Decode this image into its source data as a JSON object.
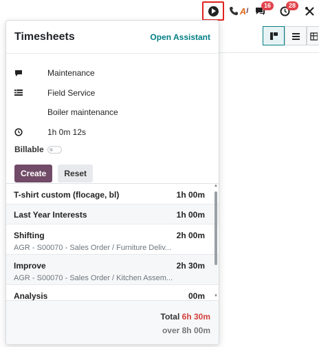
{
  "navbar": {
    "messages_badge": "16",
    "activity_badge": "28"
  },
  "popover": {
    "title": "Timesheets",
    "open_assistant": "Open Assistant",
    "form": {
      "description": "Maintenance",
      "project": "Field Service",
      "task": "Boiler maintenance",
      "duration": "1h 0m 12s",
      "billable_label": "Billable",
      "create_label": "Create",
      "reset_label": "Reset"
    },
    "entries": [
      {
        "title": "T-shirt custom (flocage, bl)",
        "time": "1h 00m",
        "subtitle": ""
      },
      {
        "title": "Last Year Interests",
        "time": "1h 00m",
        "subtitle": ""
      },
      {
        "title": "Shifting",
        "time": "2h 00m",
        "subtitle": "AGR - S00070 - Sales Order / Furniture Deliv..."
      },
      {
        "title": "Improve",
        "time": "2h 30m",
        "subtitle": "AGR - S00070 - Sales Order / Kitchen Assem..."
      },
      {
        "title": "Analysis",
        "time": "00m",
        "subtitle": ""
      }
    ],
    "footer": {
      "total_label": "Total",
      "total_value": "6h 30m",
      "over_text": "over 8h 00m"
    }
  },
  "colors": {
    "accent": "#017e84",
    "primary": "#714b67",
    "alert": "#d23f3a",
    "highlight": "#e0201b"
  }
}
